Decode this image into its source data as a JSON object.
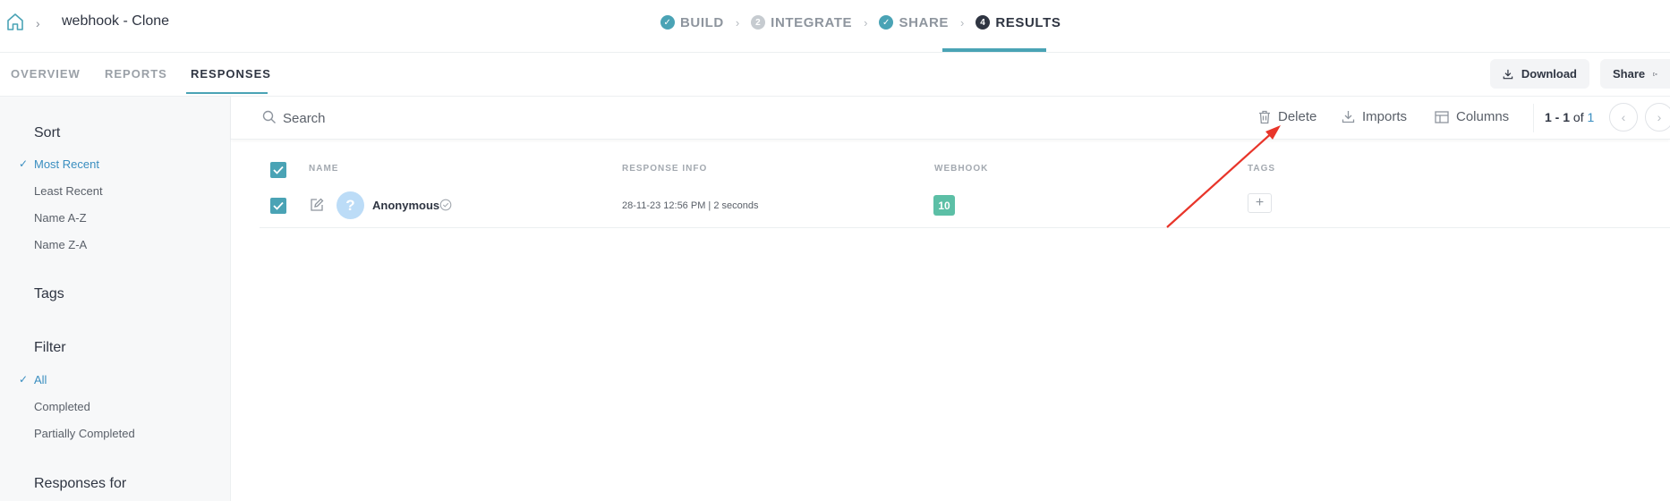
{
  "header": {
    "form_title": "webhook - Clone",
    "steps": [
      {
        "label": "BUILD",
        "state": "done",
        "badge": "✓"
      },
      {
        "label": "INTEGRATE",
        "state": "number",
        "badge": "2"
      },
      {
        "label": "SHARE",
        "state": "done",
        "badge": "✓"
      },
      {
        "label": "RESULTS",
        "state": "active",
        "badge": "4"
      }
    ]
  },
  "tabs": {
    "overview": "OVERVIEW",
    "reports": "REPORTS",
    "responses": "RESPONSES"
  },
  "actions": {
    "download": "Download",
    "share": "Share"
  },
  "sidebar": {
    "sort_heading": "Sort",
    "sort_items": [
      "Most Recent",
      "Least Recent",
      "Name A-Z",
      "Name Z-A"
    ],
    "tags_heading": "Tags",
    "filter_heading": "Filter",
    "filter_items": [
      "All",
      "Completed",
      "Partially Completed"
    ],
    "responses_for_heading": "Responses for"
  },
  "toolbar": {
    "search_placeholder": "Search",
    "delete": "Delete",
    "imports": "Imports",
    "columns": "Columns",
    "pager_range": "1 - 1",
    "pager_of": "of",
    "pager_total": "1"
  },
  "table": {
    "columns": [
      "NAME",
      "RESPONSE INFO",
      "WEBHOOK",
      "TAGS"
    ],
    "rows": [
      {
        "avatar": "?",
        "name": "Anonymous",
        "info": "28-11-23 12:56 PM | 2 seconds",
        "webhook": "10",
        "add_tag": "+"
      }
    ]
  },
  "colors": {
    "accent": "#4aa3b5",
    "link": "#3a8ec0",
    "webhook_badge": "#5cbfa6",
    "annotation_arrow": "#e8352a"
  }
}
